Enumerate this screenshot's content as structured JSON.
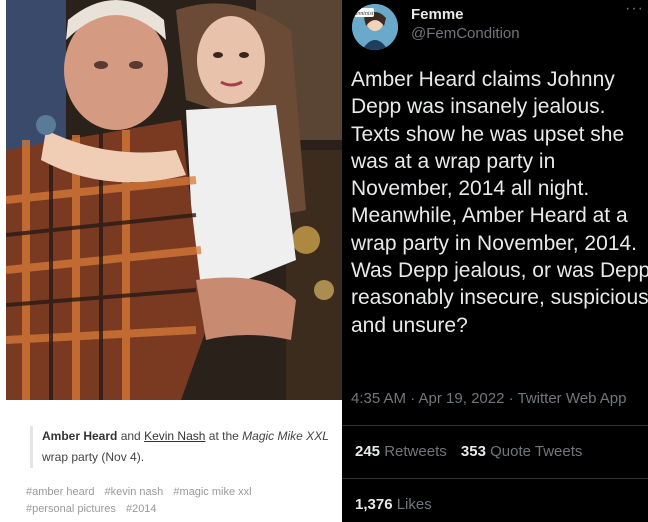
{
  "photo": {
    "description_icon": "photo"
  },
  "caption": {
    "person1": "Amber Heard",
    "and": "and",
    "person2": "Kevin Nash",
    "at_the": "at the",
    "event_italic": "Magic Mike XXL",
    "rest": "wrap party (Nov 4)."
  },
  "tags": [
    "#amber heard",
    "#kevin nash",
    "#magic mike xxl",
    "#personal pictures",
    "#2014"
  ],
  "tweet": {
    "avatar_text": "feminist",
    "display_name": "Femme",
    "handle": "@FemCondition",
    "more_icon": "···",
    "text": "Amber Heard claims Johnny Depp was insanely jealous. Texts show he was upset she was at a wrap party in November, 2014 all night. Meanwhile, Amber Heard at a wrap party in November, 2014.\nWas Depp jealous, or was Depp reasonably insecure, suspicious and unsure?",
    "meta": "4:35 AM · Apr 19, 2022 · Twitter Web App",
    "retweets_count": "245",
    "retweets_label": "Retweets",
    "quotes_count": "353",
    "quotes_label": "Quote Tweets",
    "likes_count": "1,376",
    "likes_label": "Likes"
  },
  "colors": {
    "background": "#000000",
    "text_primary": "#e7e9ea",
    "text_secondary": "#71767b",
    "divider": "#2f3336",
    "tag_gray": "#9a9a9a"
  }
}
